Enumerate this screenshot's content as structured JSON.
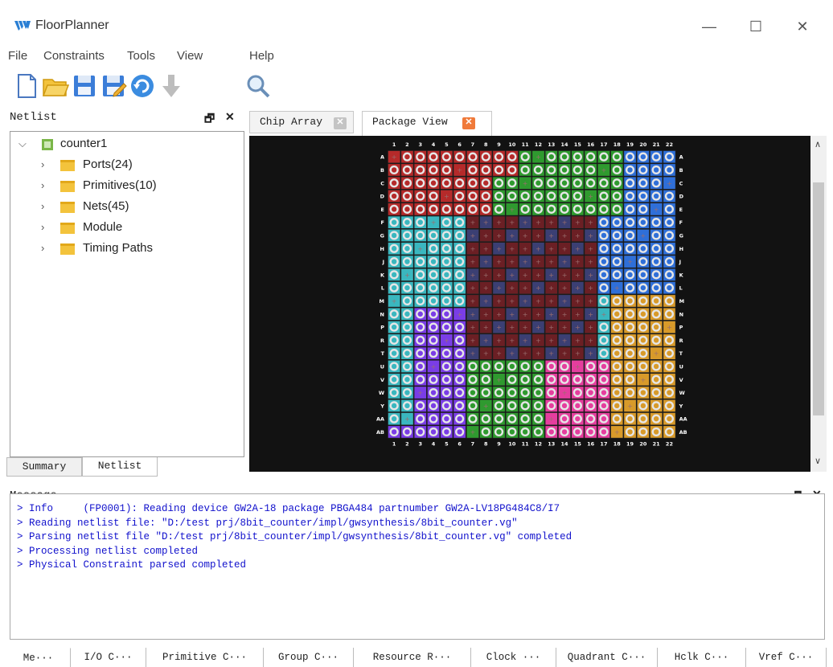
{
  "window": {
    "title": "FloorPlanner",
    "minimize": "—",
    "maximize": "☐",
    "close": "✕"
  },
  "menu": [
    "File",
    "Constraints",
    "Tools",
    "View",
    "Help"
  ],
  "toolbar": [
    {
      "icon": "new-file-icon"
    },
    {
      "icon": "open-folder-icon"
    },
    {
      "icon": "save-icon"
    },
    {
      "icon": "save-as-icon"
    },
    {
      "icon": "refresh-icon"
    },
    {
      "icon": "download-arrow-icon"
    },
    {
      "icon": "search-magnifier-icon"
    }
  ],
  "netlist": {
    "title": "Netlist",
    "dock_float": "🗗",
    "dock_close": "✕",
    "root": "counter1",
    "items": [
      "Ports(24)",
      "Primitives(10)",
      "Nets(45)",
      "Module",
      "Timing Paths"
    ]
  },
  "left_tabs": [
    "Summary",
    "Netlist"
  ],
  "doc_tabs": [
    {
      "label": "Chip Array",
      "close": "✕"
    },
    {
      "label": "Package View",
      "close": "✕"
    }
  ],
  "package": {
    "cols": [
      "1",
      "2",
      "3",
      "4",
      "5",
      "6",
      "7",
      "8",
      "9",
      "10",
      "11",
      "12",
      "13",
      "14",
      "15",
      "16",
      "17",
      "18",
      "19",
      "20",
      "21",
      "22"
    ],
    "rows": [
      "A",
      "B",
      "C",
      "D",
      "E",
      "F",
      "G",
      "H",
      "J",
      "K",
      "L",
      "M",
      "N",
      "P",
      "R",
      "T",
      "U",
      "V",
      "W",
      "Y",
      "AA",
      "AB"
    ],
    "bank_colors": {
      "red": "#b52a2a",
      "green": "#2f9a2f",
      "blue": "#2f6fd8",
      "cyan": "#3ab7bf",
      "maroon": "#6b1f24",
      "navy": "#3b3f73",
      "purple": "#7a3de6",
      "pink": "#e53e9e",
      "orange": "#d89a2a"
    }
  },
  "message": {
    "title": "Message",
    "lines": [
      "> Info     (FP0001): Reading device GW2A-18 package PBGA484 partnumber GW2A-LV18PG484C8/I7",
      "> Reading netlist file: \"D:/test prj/8bit_counter/impl/gwsynthesis/8bit_counter.vg\"",
      "> Parsing netlist file \"D:/test prj/8bit_counter/impl/gwsynthesis/8bit_counter.vg\" completed",
      "> Processing netlist completed",
      "> Physical Constraint parsed completed"
    ]
  },
  "bottom_tabs": [
    "Me···",
    "I/O C···",
    "Primitive C···",
    "Group C···",
    "Resource R···",
    "Clock ···",
    "Quadrant C···",
    "Hclk C···",
    "Vref C···"
  ]
}
